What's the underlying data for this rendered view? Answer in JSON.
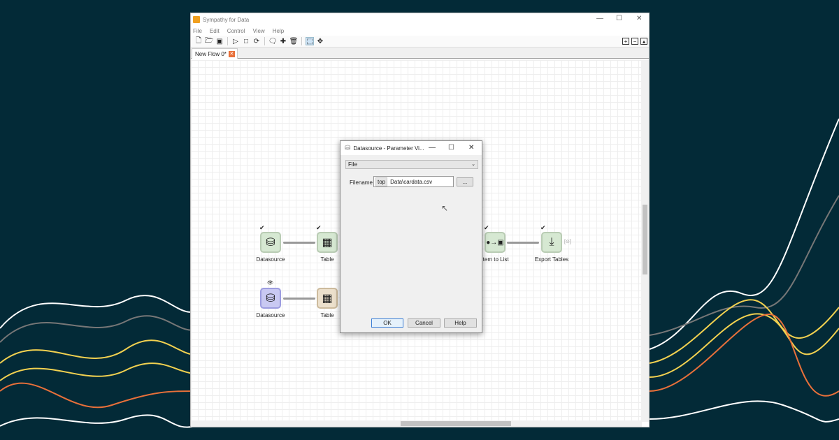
{
  "window": {
    "title": "Sympathy for Data",
    "menu": [
      "File",
      "Edit",
      "Control",
      "View",
      "Help"
    ],
    "tab": "New Flow 0*"
  },
  "nodes": [
    {
      "label": "Datasource",
      "status": "✔"
    },
    {
      "label": "Table",
      "status": "✔"
    },
    {
      "label": "Item to List",
      "status": "✔"
    },
    {
      "label": "Export Tables",
      "status": "✔"
    },
    {
      "label": "Datasource",
      "status": "👁"
    },
    {
      "label": "Table",
      "status": ""
    }
  ],
  "export_port": "[⊙]",
  "dialog": {
    "title": "Datasource - Parameter Vi...",
    "mode": "File",
    "filename_label": "Filename",
    "prefix": "top",
    "filename": "Data\\cardata.csv",
    "browse": "...",
    "ok": "OK",
    "cancel": "Cancel",
    "help": "Help"
  },
  "colors": {
    "background": "#032a37",
    "accent": "#e8703a",
    "yellow": "#f2d150"
  }
}
